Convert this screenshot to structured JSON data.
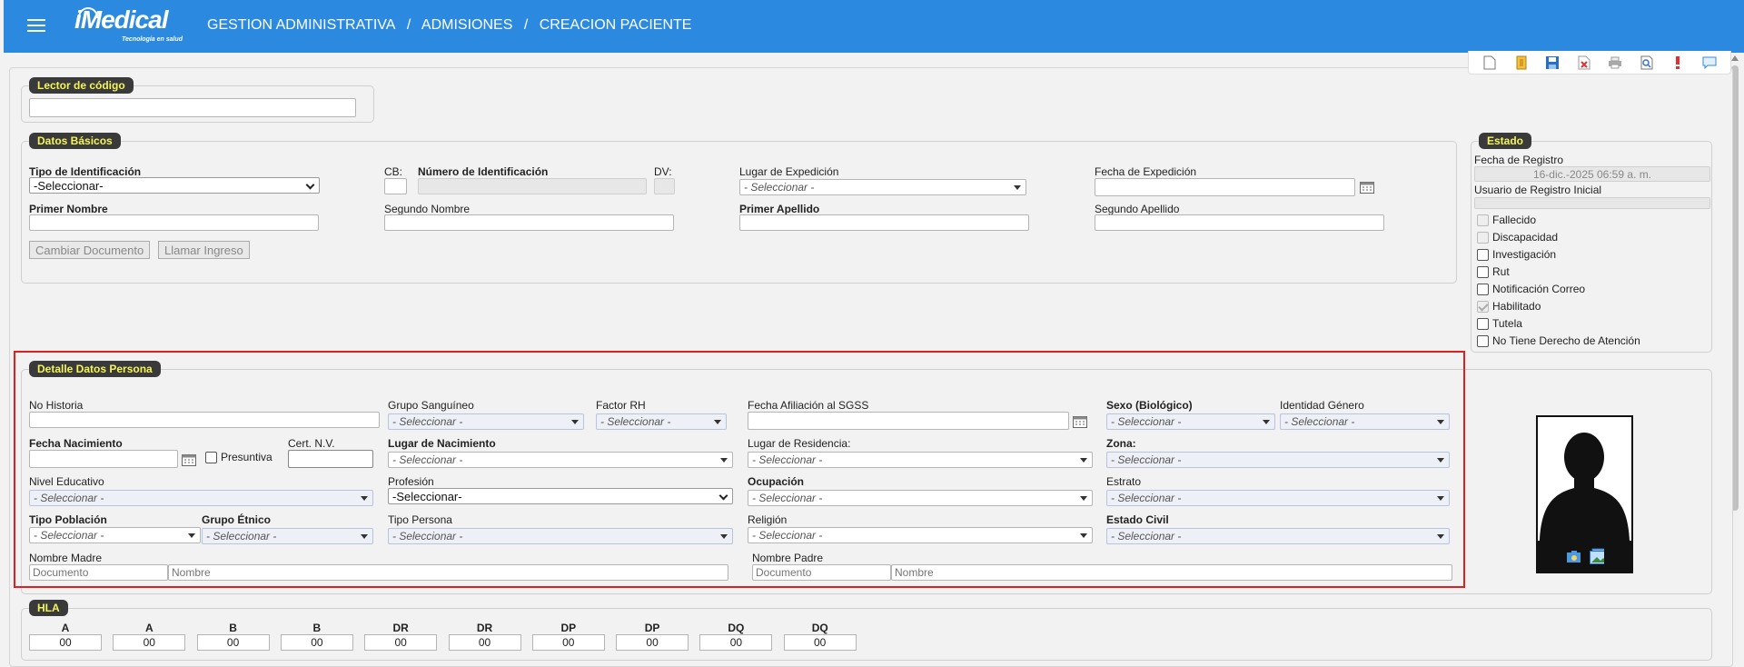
{
  "header": {
    "logo_text": "iMedical",
    "logo_tagline": "Tecnología en salud",
    "breadcrumb": [
      "GESTION ADMINISTRATIVA",
      "/",
      "ADMISIONES",
      "/",
      "CREACION PACIENTE"
    ]
  },
  "toolbar": {
    "icons": [
      "new-document-icon",
      "open-folder-icon",
      "save-icon",
      "delete-icon",
      "print-icon",
      "preview-icon",
      "alert-icon",
      "comment-icon"
    ]
  },
  "lector": {
    "legend": "Lector de código",
    "value": ""
  },
  "basicos": {
    "legend": "Datos Básicos",
    "tipo_id_label": "Tipo de Identificación",
    "tipo_id_value": "-Seleccionar-",
    "cb_label": "CB:",
    "numero_label": "Número de Identificación",
    "dv_label": "DV:",
    "lugar_exp_label": "Lugar de Expedición",
    "lugar_exp_value": "- Seleccionar -",
    "fecha_exp_label": "Fecha de Expedición",
    "primer_nombre_label": "Primer Nombre",
    "segundo_nombre_label": "Segundo Nombre",
    "primer_apellido_label": "Primer Apellido",
    "segundo_apellido_label": "Segundo Apellido",
    "btn_cambiar": "Cambiar Documento",
    "btn_llamar": "Llamar Ingreso"
  },
  "estado": {
    "legend": "Estado",
    "fecha_registro_label": "Fecha de Registro",
    "fecha_registro_value": "16-dic.-2025 06:59 a. m.",
    "usuario_label": "Usuario de Registro Inicial",
    "checks": [
      {
        "label": "Fallecido",
        "checked": false,
        "disabled": true
      },
      {
        "label": "Discapacidad",
        "checked": false,
        "disabled": true
      },
      {
        "label": "Investigación",
        "checked": false,
        "disabled": false
      },
      {
        "label": "Rut",
        "checked": false,
        "disabled": false
      },
      {
        "label": "Notificación Correo",
        "checked": false,
        "disabled": false
      },
      {
        "label": "Habilitado",
        "checked": true,
        "disabled": true
      },
      {
        "label": "Tutela",
        "checked": false,
        "disabled": false
      },
      {
        "label": "No Tiene Derecho de Atención",
        "checked": false,
        "disabled": false
      }
    ]
  },
  "detalle": {
    "legend": "Detalle Datos Persona",
    "no_historia": "No Historia",
    "grupo_sanguineo": "Grupo Sanguíneo",
    "factor_rh": "Factor RH",
    "fecha_afiliacion": "Fecha Afiliación al SGSS",
    "sexo": "Sexo (Biológico)",
    "identidad_genero": "Identidad Género",
    "fecha_nacimiento": "Fecha Nacimiento",
    "presuntiva": "Presuntiva",
    "cert_nv": "Cert. N.V.",
    "lugar_nacimiento": "Lugar de Nacimiento",
    "lugar_residencia": "Lugar de Residencia:",
    "zona": "Zona:",
    "nivel_educativo": "Nivel Educativo",
    "profesion": "Profesión",
    "profesion_value": "-Seleccionar-",
    "ocupacion": "Ocupación",
    "estrato": "Estrato",
    "tipo_poblacion": "Tipo Población",
    "grupo_etnico": "Grupo Étnico",
    "tipo_persona": "Tipo Persona",
    "religion": "Religión",
    "estado_civil": "Estado Civil",
    "nombre_madre": "Nombre Madre",
    "nombre_padre": "Nombre Padre",
    "placeholder_documento": "Documento",
    "placeholder_nombre": "Nombre",
    "select_placeholder": "- Seleccionar -"
  },
  "hla": {
    "legend": "HLA",
    "labels": [
      "A",
      "A",
      "B",
      "B",
      "DR",
      "DR",
      "DP",
      "DP",
      "DQ",
      "DQ"
    ],
    "values": [
      "00",
      "00",
      "00",
      "00",
      "00",
      "00",
      "00",
      "00",
      "00",
      "00"
    ]
  }
}
